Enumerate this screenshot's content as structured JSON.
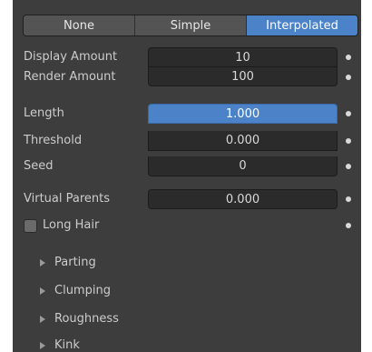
{
  "child_mode": {
    "options": [
      {
        "label": "None",
        "active": false
      },
      {
        "label": "Simple",
        "active": false
      },
      {
        "label": "Interpolated",
        "active": true
      }
    ]
  },
  "display_amount": {
    "label": "Display Amount",
    "value": "10"
  },
  "render_amount": {
    "label": "Render Amount",
    "value": "100"
  },
  "length": {
    "label": "Length",
    "value": "1.000"
  },
  "threshold": {
    "label": "Threshold",
    "value": "0.000"
  },
  "seed": {
    "label": "Seed",
    "value": "0"
  },
  "virtual_parents": {
    "label": "Virtual Parents",
    "value": "0.000"
  },
  "long_hair": {
    "label": "Long Hair",
    "checked": false
  },
  "subpanels": [
    {
      "label": "Parting"
    },
    {
      "label": "Clumping"
    },
    {
      "label": "Roughness"
    },
    {
      "label": "Kink"
    }
  ],
  "colors": {
    "panel_bg": "#3d3d3d",
    "field_bg": "#2b2b2b",
    "accent": "#4b82c8"
  }
}
